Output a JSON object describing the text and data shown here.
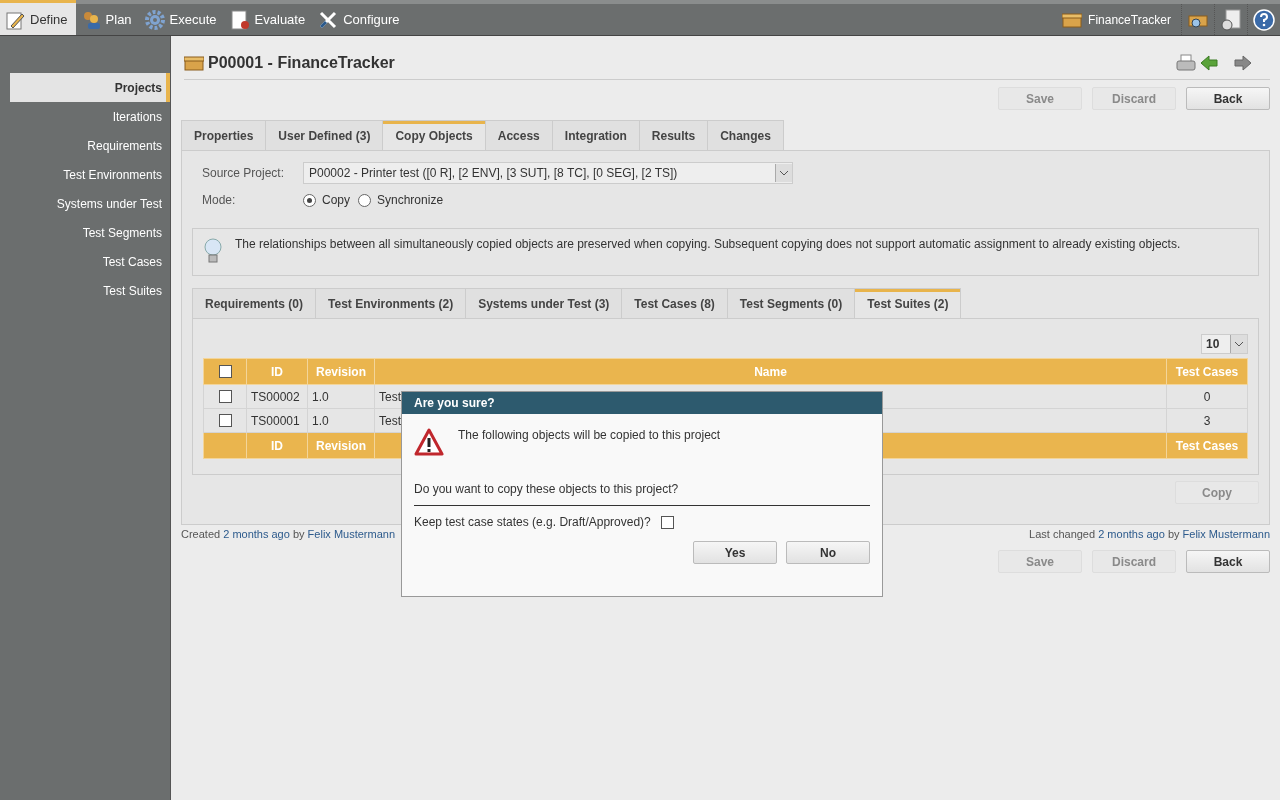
{
  "top_menu": [
    {
      "label": "Define",
      "selected": true
    },
    {
      "label": "Plan",
      "selected": false
    },
    {
      "label": "Execute",
      "selected": false
    },
    {
      "label": "Evaluate",
      "selected": false
    },
    {
      "label": "Configure",
      "selected": false
    }
  ],
  "current_project": "FinanceTracker",
  "sidebar": {
    "items": [
      {
        "label": "Projects",
        "selected": true
      },
      {
        "label": "Iterations",
        "selected": false
      },
      {
        "label": "Requirements",
        "selected": false
      },
      {
        "label": "Test Environments",
        "selected": false
      },
      {
        "label": "Systems under Test",
        "selected": false
      },
      {
        "label": "Test Segments",
        "selected": false
      },
      {
        "label": "Test Cases",
        "selected": false
      },
      {
        "label": "Test Suites",
        "selected": false
      }
    ]
  },
  "title": "P00001 - FinanceTracker",
  "top_buttons": [
    {
      "label": "Save",
      "disabled": true
    },
    {
      "label": "Discard",
      "disabled": true
    },
    {
      "label": "Back",
      "disabled": false
    }
  ],
  "tabs": [
    {
      "label": "Properties",
      "selected": false
    },
    {
      "label": "User Defined (3)",
      "selected": false
    },
    {
      "label": "Copy Objects",
      "selected": true
    },
    {
      "label": "Access",
      "selected": false
    },
    {
      "label": "Integration",
      "selected": false
    },
    {
      "label": "Results",
      "selected": false
    },
    {
      "label": "Changes",
      "selected": false
    }
  ],
  "source_project": {
    "label": "Source Project:",
    "value": "P00002 - Printer test ([0 R], [2 ENV], [3 SUT], [8 TC], [0 SEG], [2 TS])"
  },
  "mode": {
    "label": "Mode:",
    "options": [
      {
        "label": "Copy",
        "selected": true
      },
      {
        "label": "Synchronize",
        "selected": false
      }
    ]
  },
  "info": "The relationships between all simultaneously copied objects are preserved when copying. Subsequent copying does not support automatic assignment to already existing objects.",
  "sub_tabs": [
    {
      "label": "Requirements (0)",
      "selected": false
    },
    {
      "label": "Test Environments (2)",
      "selected": false
    },
    {
      "label": "Systems under Test (3)",
      "selected": false
    },
    {
      "label": "Test Cases (8)",
      "selected": false
    },
    {
      "label": "Test Segments (0)",
      "selected": false
    },
    {
      "label": "Test Suites (2)",
      "selected": true
    }
  ],
  "page_size": "10",
  "table": {
    "select_all_checked": false,
    "columns": [
      "ID",
      "Revision",
      "Name",
      "Test Cases"
    ],
    "rows": [
      {
        "checked": false,
        "cells": [
          "TS00002",
          "1.0",
          "Test",
          "0"
        ]
      },
      {
        "checked": false,
        "cells": [
          "TS00001",
          "1.0",
          "Test",
          "3"
        ]
      }
    ],
    "footer": [
      "ID",
      "Revision",
      "Test Cases"
    ]
  },
  "copy_button": {
    "label": "Copy",
    "disabled": true
  },
  "created": {
    "prefix": "Created",
    "time": "2 months ago",
    "by": "by",
    "user": "Felix Mustermann"
  },
  "last_changed": {
    "prefix": "Last changed",
    "time": "2 months ago",
    "by": "by",
    "user": "Felix Mustermann"
  },
  "bottom_buttons": [
    {
      "label": "Save",
      "disabled": true
    },
    {
      "label": "Discard",
      "disabled": true
    },
    {
      "label": "Back",
      "disabled": false
    }
  ],
  "dialog": {
    "title": "Are you sure?",
    "message": "The following objects will be copied to this project",
    "question": "Do you want to copy these objects to this project?",
    "keep_label": "Keep test case states (e.g. Draft/Approved)?",
    "keep_checked": false,
    "buttons": [
      "Yes",
      "No"
    ]
  }
}
